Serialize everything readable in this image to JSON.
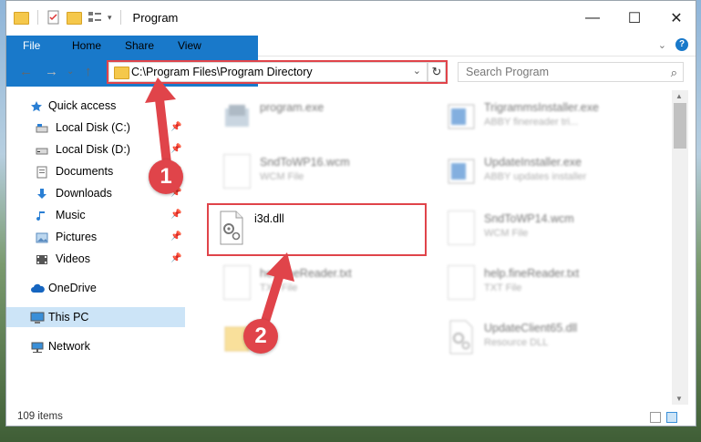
{
  "window": {
    "title": "Program",
    "controls": {
      "minimize": "—",
      "maximize": "☐",
      "close": "✕"
    }
  },
  "ribbon": {
    "tabs": [
      "File",
      "Home",
      "Share",
      "View"
    ]
  },
  "address": {
    "path": "C:\\Program Files\\Program Directory"
  },
  "search": {
    "placeholder": "Search Program"
  },
  "sidebar": {
    "items": [
      {
        "label": "Quick access",
        "icon": "star-icon"
      },
      {
        "label": "Local Disk (C:)",
        "icon": "drive-icon",
        "pinned": true
      },
      {
        "label": "Local Disk (D:)",
        "icon": "drive-icon",
        "pinned": true
      },
      {
        "label": "Documents",
        "icon": "documents-icon",
        "pinned": true
      },
      {
        "label": "Downloads",
        "icon": "downloads-icon",
        "pinned": true
      },
      {
        "label": "Music",
        "icon": "music-icon",
        "pinned": true
      },
      {
        "label": "Pictures",
        "icon": "pictures-icon",
        "pinned": true
      },
      {
        "label": "Videos",
        "icon": "videos-icon",
        "pinned": true
      },
      {
        "label": "OneDrive",
        "icon": "cloud-icon"
      },
      {
        "label": "This PC",
        "icon": "computer-icon",
        "selected": true
      },
      {
        "label": "Network",
        "icon": "network-icon"
      }
    ]
  },
  "files": [
    {
      "name": "program.exe",
      "type": "",
      "icon": "exe-icon"
    },
    {
      "name": "TrigrammsInstaller.exe",
      "type": "ABBY finereader tri...",
      "icon": "installer-icon"
    },
    {
      "name": "SndToWP16.wcm",
      "type": "WCM File",
      "icon": "document-icon"
    },
    {
      "name": "UpdateInstaller.exe",
      "type": "ABBY updates installer",
      "icon": "installer-icon"
    },
    {
      "name": "i3d.dll",
      "type": "",
      "icon": "dll-gear-icon"
    },
    {
      "name": "SndToWP14.wcm",
      "type": "WCM File",
      "icon": "document-icon"
    },
    {
      "name": "helpfineReader.txt",
      "type": "TXT File",
      "icon": "document-icon"
    },
    {
      "name": "help.fineReader.txt",
      "type": "TXT File",
      "icon": "document-icon"
    },
    {
      "name": "",
      "type": "",
      "icon": "folder-icon"
    },
    {
      "name": "UpdateClient65.dll",
      "type": "Resource DLL",
      "icon": "dll-gear-icon"
    }
  ],
  "status": {
    "item_count": "109 items"
  },
  "annotations": {
    "step1": "1",
    "step2": "2",
    "color": "#e0444a"
  },
  "colors": {
    "accent": "#1979ca",
    "selected": "#cce4f7"
  }
}
